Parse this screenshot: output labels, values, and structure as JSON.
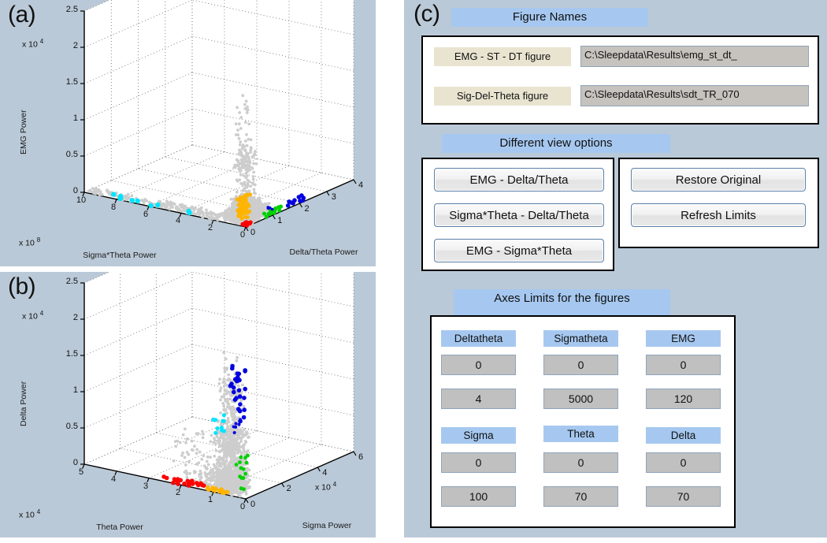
{
  "figure": {
    "panel_a_tag": "(a)",
    "panel_b_tag": "(b)",
    "panel_c_tag": "(c)"
  },
  "chart_data": [
    {
      "id": "panel-a",
      "type": "scatter",
      "projection": "3d",
      "title": "(a)",
      "xlabel": "Sigma*Theta Power",
      "ylabel": "Delta/Theta Power",
      "zlabel": "EMG Power",
      "x_exponent": "x 10",
      "x_exponent_power": "8",
      "z_exponent": "x 10",
      "z_exponent_power": "4",
      "xticks": [
        "10",
        "8",
        "6",
        "4",
        "2",
        "0"
      ],
      "yticks": [
        "0",
        "1",
        "2",
        "3",
        "4"
      ],
      "zticks": [
        "0",
        "0.5",
        "1",
        "1.5",
        "2",
        "2.5"
      ],
      "xlim": [
        0,
        10
      ],
      "ylim": [
        0,
        4
      ],
      "zlim": [
        0,
        2.5
      ],
      "grid": true,
      "legend": "none",
      "series": [
        {
          "name": "unclassified",
          "color": "#cdcdcd",
          "count": 1400
        },
        {
          "name": "cluster-cyan",
          "color": "#00e5ff",
          "count": 12
        },
        {
          "name": "cluster-gold",
          "color": "#ffb400",
          "count": 60
        },
        {
          "name": "cluster-green",
          "color": "#00d000",
          "count": 18
        },
        {
          "name": "cluster-blue",
          "color": "#0000e0",
          "count": 10
        },
        {
          "name": "cluster-red",
          "color": "#ff0000",
          "count": 18
        }
      ]
    },
    {
      "id": "panel-b",
      "type": "scatter",
      "projection": "3d",
      "title": "(b)",
      "xlabel": "Theta Power",
      "ylabel": "Sigma Power",
      "zlabel": "Delta Power",
      "x_exponent": "x 10",
      "x_exponent_power": "4",
      "y_exponent": "x 10",
      "y_exponent_power": "4",
      "z_exponent": "x 10",
      "z_exponent_power": "4",
      "xticks": [
        "5",
        "4",
        "3",
        "2",
        "1",
        "0"
      ],
      "yticks": [
        "0",
        "2",
        "4",
        "6"
      ],
      "zticks": [
        "0",
        "0.5",
        "1",
        "1.5",
        "2",
        "2.5"
      ],
      "xlim": [
        0,
        5
      ],
      "ylim": [
        0,
        6
      ],
      "zlim": [
        0,
        2.5
      ],
      "grid": true,
      "legend": "none",
      "series": [
        {
          "name": "unclassified",
          "color": "#cdcdcd",
          "count": 1400
        },
        {
          "name": "cluster-blue",
          "color": "#0000e0",
          "count": 30
        },
        {
          "name": "cluster-cyan",
          "color": "#00e5ff",
          "count": 14
        },
        {
          "name": "cluster-green",
          "color": "#00d000",
          "count": 16
        },
        {
          "name": "cluster-red",
          "color": "#ff0000",
          "count": 22
        },
        {
          "name": "cluster-gold",
          "color": "#ffb400",
          "count": 22
        }
      ]
    }
  ],
  "controls": {
    "figure_names": {
      "header": "Figure Names",
      "rows": [
        {
          "label": "EMG - ST - DT figure",
          "value": "C:\\Sleepdata\\Results\\emg_st_dt_"
        },
        {
          "label": "Sig-Del-Theta figure",
          "value": "C:\\Sleepdata\\Results\\sdt_TR_070"
        }
      ]
    },
    "view_options": {
      "header": "Different view options",
      "left_buttons": [
        "EMG - Delta/Theta",
        "Sigma*Theta - Delta/Theta",
        "EMG - Sigma*Theta"
      ],
      "right_buttons": [
        "Restore Original",
        "Refresh Limits"
      ]
    },
    "axes_limits": {
      "header": "Axes Limits for the figures",
      "groups": [
        {
          "label": "Deltatheta",
          "min": "0",
          "max": "4"
        },
        {
          "label": "Sigmatheta",
          "min": "0",
          "max": "5000"
        },
        {
          "label": "EMG",
          "min": "0",
          "max": "120"
        },
        {
          "label": "Sigma",
          "min": "0",
          "max": "100"
        },
        {
          "label": "Theta",
          "min": "0",
          "max": "70"
        },
        {
          "label": "Delta",
          "min": "0",
          "max": "70"
        }
      ]
    }
  },
  "colors": {
    "panel_background": "#bac9d7",
    "header_blue": "#a6c8f0",
    "tan_label": "#e8e4d0",
    "field_gray": "#c0c0c0",
    "button_border": "#5b7fa6"
  }
}
